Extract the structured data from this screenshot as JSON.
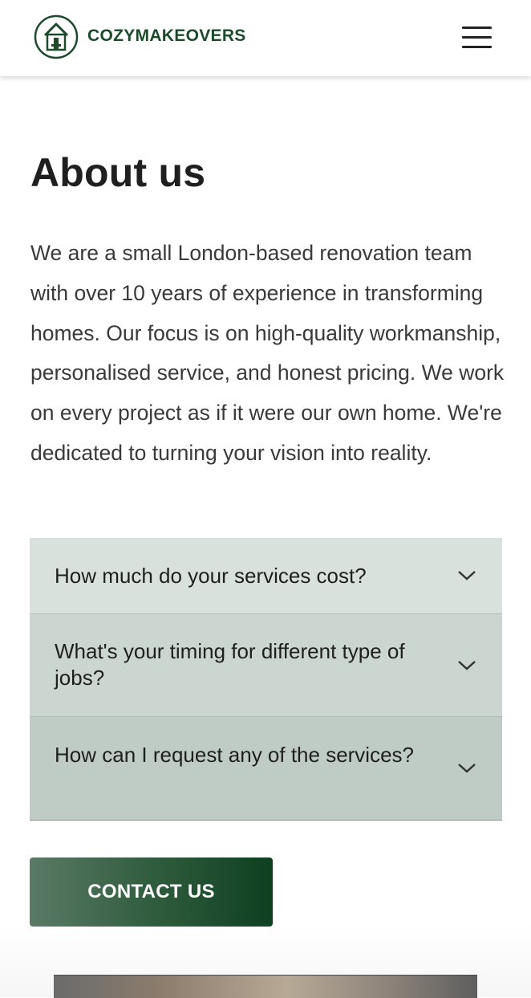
{
  "header": {
    "brand": "COZYMAKEOVERS",
    "logo_icon": "house-logo-icon",
    "menu_icon": "hamburger-menu-icon"
  },
  "about": {
    "title": "About us",
    "text": "We are a small London-based renovation team with over 10 years of experience in transforming homes. Our focus is on high-quality workmanship, personalised service, and honest pricing. We work on every project as if it were our own home. We're dedicated to turning your vision into reality."
  },
  "faq": {
    "items": [
      {
        "question": "How much do your services cost?",
        "bg": "#d9e1dc"
      },
      {
        "question": "What's your timing for different type of jobs?",
        "bg": "#ccd6d0"
      },
      {
        "question": "How can I request any of the services?",
        "bg": "#bfccc5"
      }
    ],
    "chevron_icon": "chevron-down-icon"
  },
  "cta": {
    "label": "CONTACT US"
  },
  "colors": {
    "brand": "#1c4a2b",
    "button_start": "#5a7a66",
    "button_end": "#0d4020"
  }
}
